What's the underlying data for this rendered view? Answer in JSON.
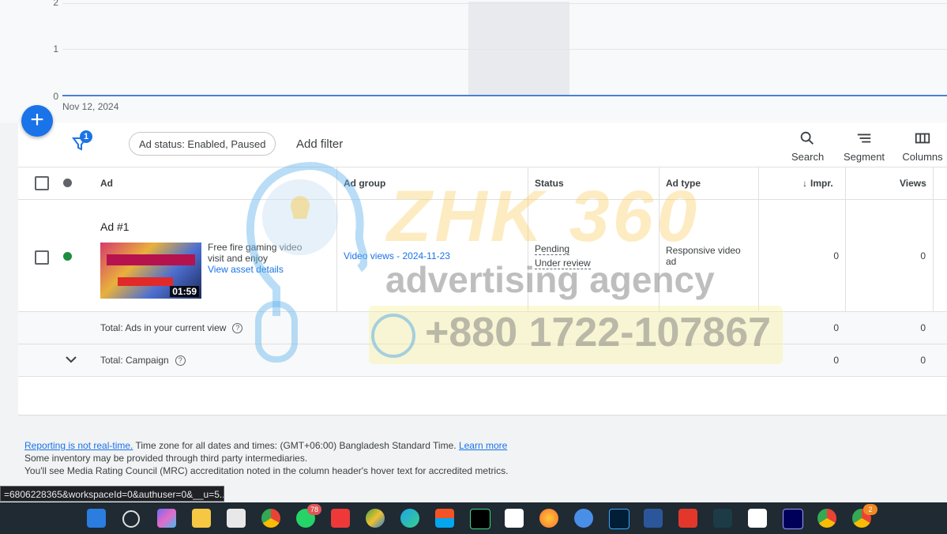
{
  "chart": {
    "y_ticks": [
      "2",
      "1",
      "0"
    ],
    "x_start_label": "Nov 12, 2024"
  },
  "fab": {
    "label": "+"
  },
  "filter_bar": {
    "filter_count": "1",
    "chip_label": "Ad status: Enabled, Paused",
    "add_filter_label": "Add filter",
    "tools": [
      "Search",
      "Segment",
      "Columns"
    ]
  },
  "table": {
    "headers": {
      "ad": "Ad",
      "ad_group": "Ad group",
      "status": "Status",
      "ad_type": "Ad type",
      "impr": "Impr.",
      "views": "Views"
    },
    "rows": [
      {
        "ad_name": "Ad #1",
        "ad_description_line1": "Free fire gaming video",
        "ad_description_line2": "visit and enjoy",
        "view_asset_link": "View asset details",
        "thumbnail_duration": "01:59",
        "status_dot_color": "#1e8e3e",
        "ad_group": "Video views - 2024-11-23",
        "status_line1": "Pending",
        "status_line2": "Under review",
        "ad_type_line1": "Responsive video",
        "ad_type_line2": "ad",
        "impr": "0",
        "views": "0"
      }
    ],
    "totals": [
      {
        "label": "Total: Ads in your current view",
        "impr": "0",
        "views": "0"
      },
      {
        "label": "Total: Campaign",
        "impr": "0",
        "views": "0"
      }
    ]
  },
  "watermark": {
    "title": "ZHK 360",
    "subtitle": "advertising agency",
    "phone": "+880 1722-107867"
  },
  "footer": {
    "reporting_link": "Reporting is not real-time.",
    "timezone_text": " Time zone for all dates and times: (GMT+06:00) Bangladesh Standard Time. ",
    "learn_more": "Learn more",
    "line2": "Some inventory may be provided through third party intermediaries.",
    "line3": "You'll see Media Rating Council (MRC) accreditation noted in the column header's hover text for accredited metrics."
  },
  "status_url": "=6806228365&workspaceId=0&authuser=0&__u=5...",
  "taskbar": {
    "whatsapp_badge": "78",
    "chrome_profile_badge": "2"
  },
  "colors": {
    "accent": "#1a73e8",
    "enabled_green": "#1e8e3e",
    "taskbar": "#1f2a33"
  }
}
